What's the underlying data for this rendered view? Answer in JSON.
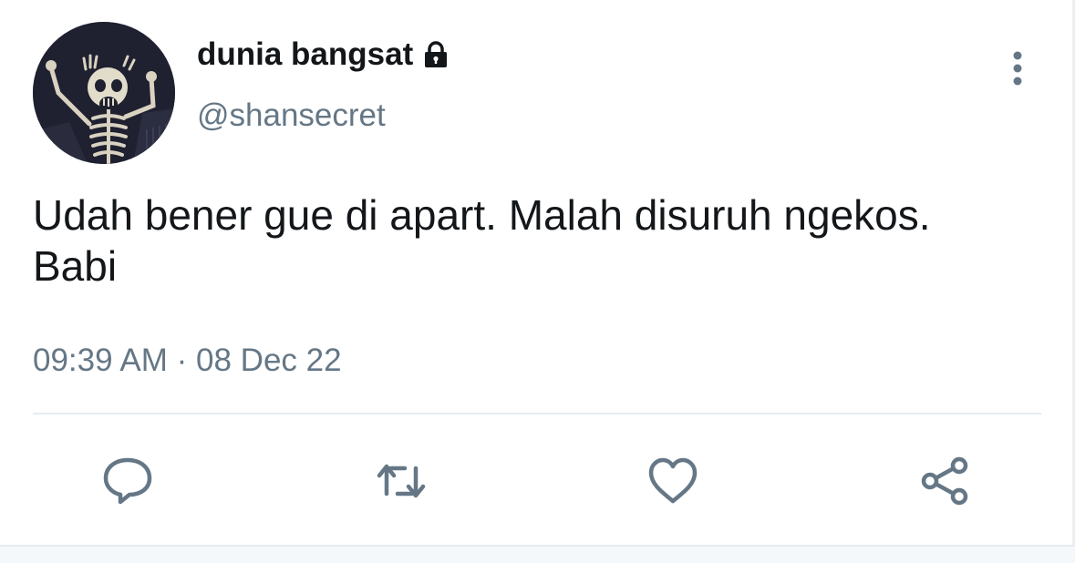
{
  "user": {
    "display_name": "dunia bangsat",
    "handle": "@shansecret",
    "protected_icon": "lock-icon",
    "avatar_icon": "skeleton-avatar"
  },
  "tweet": {
    "text": "Udah bener gue di apart. Malah disuruh ngekos. Babi",
    "time": "09:39 AM",
    "separator": "·",
    "date": "08 Dec 22"
  },
  "actions": [
    {
      "name": "reply",
      "icon": "reply-icon"
    },
    {
      "name": "retweet",
      "icon": "retweet-icon"
    },
    {
      "name": "like",
      "icon": "heart-icon"
    },
    {
      "name": "share",
      "icon": "share-icon"
    }
  ],
  "colors": {
    "text_primary": "#14171a",
    "text_secondary": "#657786",
    "divider": "#e6ecf0"
  }
}
